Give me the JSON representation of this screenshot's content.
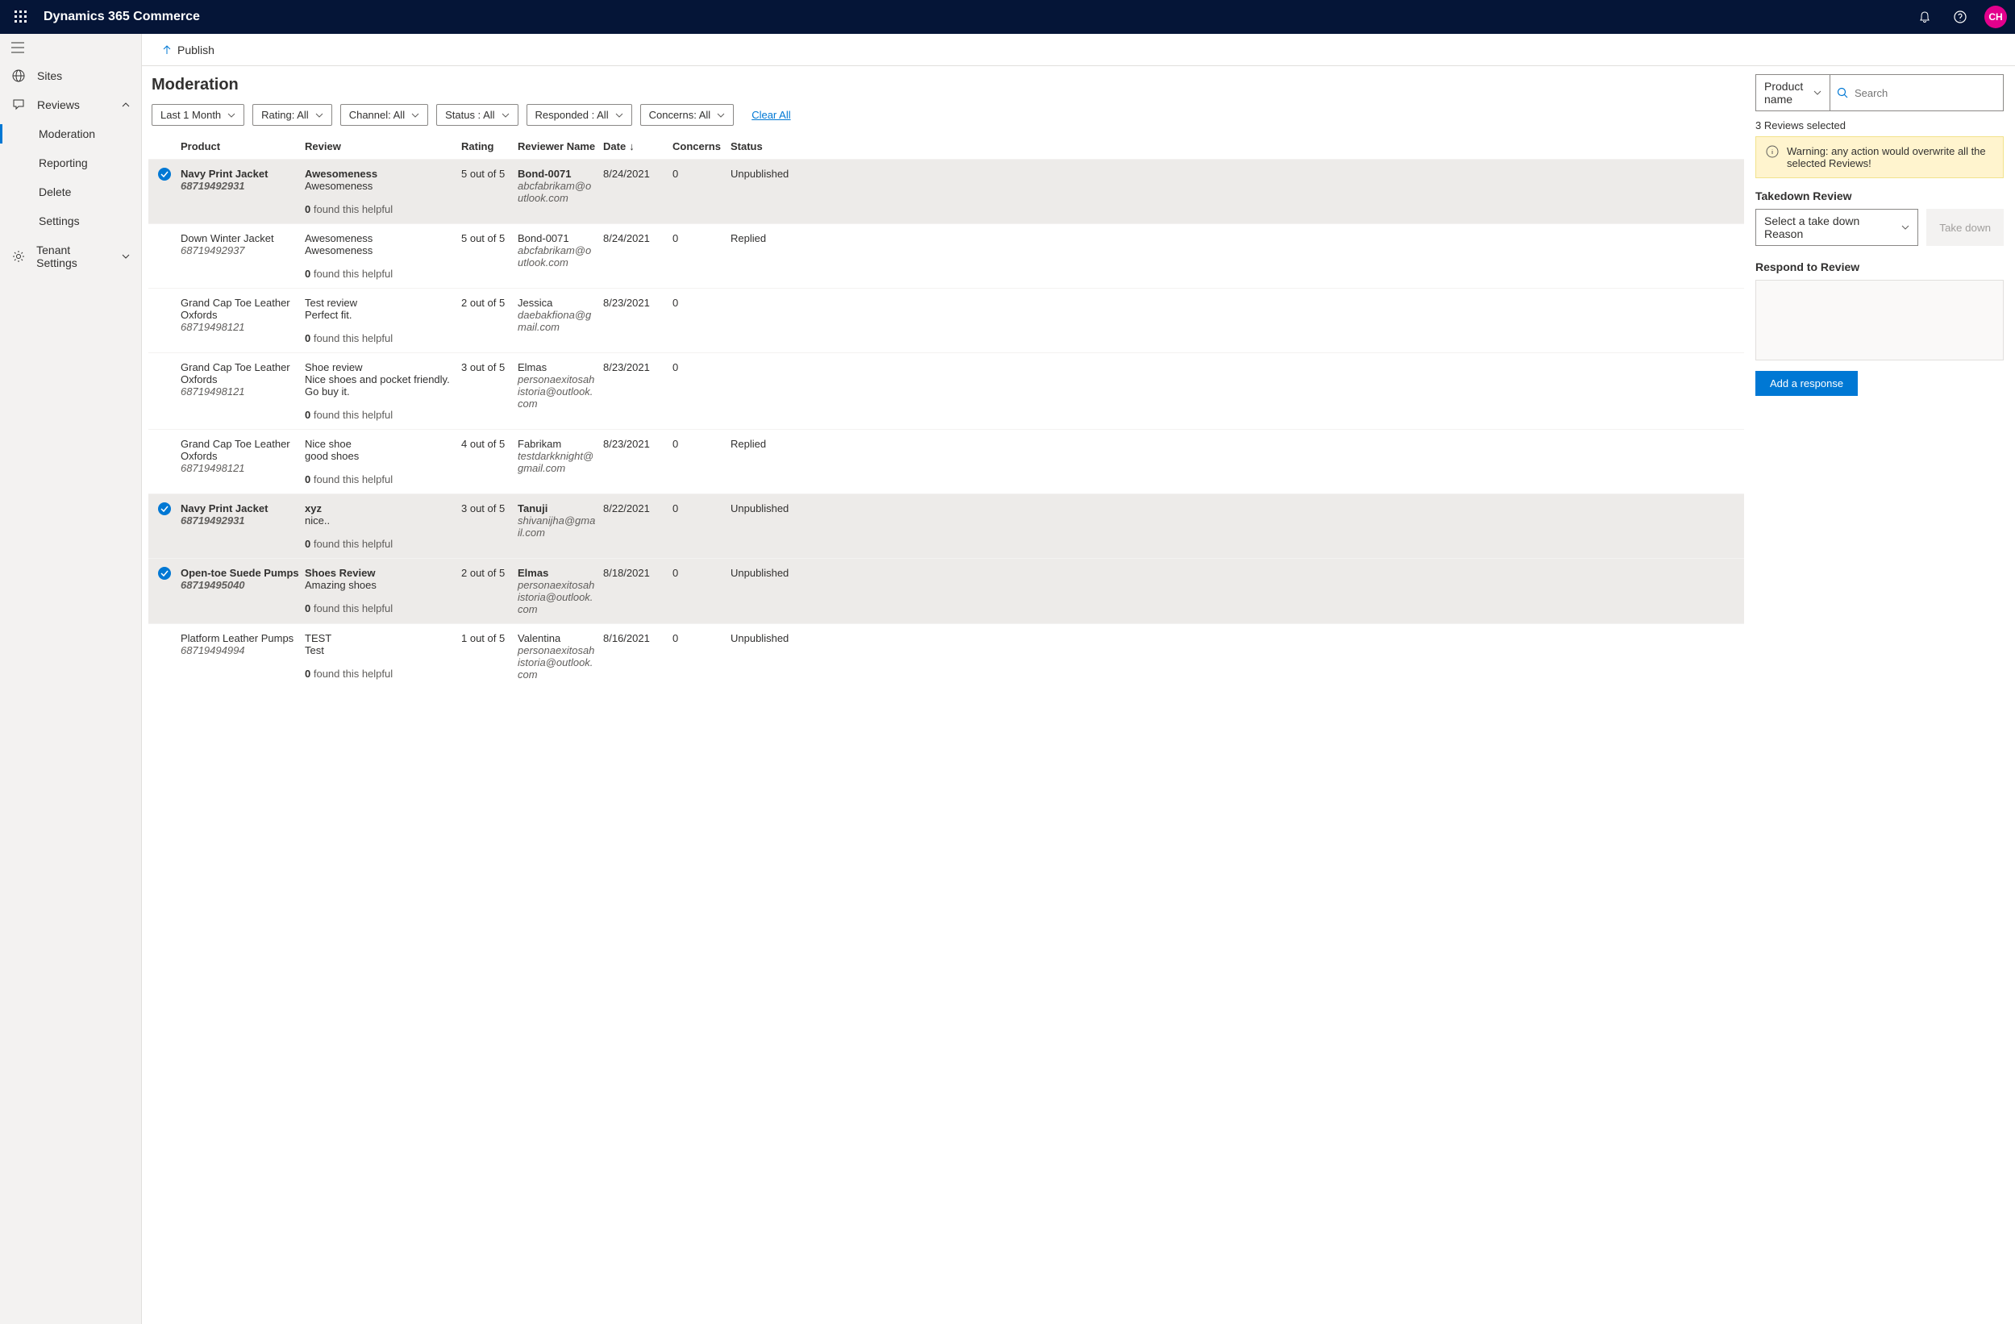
{
  "header": {
    "appTitle": "Dynamics 365 Commerce",
    "avatar": "CH"
  },
  "sidebar": {
    "sites": "Sites",
    "reviews": "Reviews",
    "moderation": "Moderation",
    "reporting": "Reporting",
    "delete": "Delete",
    "settings": "Settings",
    "tenantSettings": "Tenant Settings"
  },
  "cmdbar": {
    "publish": "Publish"
  },
  "pageTitle": "Moderation",
  "filters": {
    "dateRange": "Last 1 Month",
    "rating": "Rating: All",
    "channel": "Channel: All",
    "status": "Status : All",
    "responded": "Responded : All",
    "concerns": "Concerns: All",
    "clearAll": "Clear All"
  },
  "columns": {
    "product": "Product",
    "review": "Review",
    "rating": "Rating",
    "reviewer": "Reviewer Name",
    "date": "Date",
    "concerns": "Concerns",
    "status": "Status"
  },
  "rows": [
    {
      "selected": true,
      "product": "Navy Print Jacket",
      "pid": "68719492931",
      "title": "Awesomeness",
      "body": "Awesomeness",
      "helpful": "0",
      "rating": "5 out of 5",
      "reviewer": "Bond-0071",
      "email": "abcfabrikam@outlook.com",
      "date": "8/24/2021",
      "concerns": "0",
      "status": "Unpublished"
    },
    {
      "selected": false,
      "product": "Down Winter Jacket",
      "pid": "68719492937",
      "title": "Awesomeness",
      "body": "Awesomeness",
      "helpful": "0",
      "rating": "5 out of 5",
      "reviewer": "Bond-0071",
      "email": "abcfabrikam@outlook.com",
      "date": "8/24/2021",
      "concerns": "0",
      "status": "Replied"
    },
    {
      "selected": false,
      "product": "Grand Cap Toe Leather Oxfords",
      "pid": "68719498121",
      "title": "Test review",
      "body": "Perfect fit.",
      "helpful": "0",
      "rating": "2 out of 5",
      "reviewer": "Jessica",
      "email": "daebakfiona@gmail.com",
      "date": "8/23/2021",
      "concerns": "0",
      "status": ""
    },
    {
      "selected": false,
      "product": "Grand Cap Toe Leather Oxfords",
      "pid": "68719498121",
      "title": "Shoe review",
      "body": "Nice shoes and pocket friendly. Go buy it.",
      "helpful": "0",
      "rating": "3 out of 5",
      "reviewer": "Elmas",
      "email": "personaexitosahistoria@outlook.com",
      "date": "8/23/2021",
      "concerns": "0",
      "status": ""
    },
    {
      "selected": false,
      "product": "Grand Cap Toe Leather Oxfords",
      "pid": "68719498121",
      "title": "Nice shoe",
      "body": "good shoes",
      "helpful": "0",
      "rating": "4 out of 5",
      "reviewer": "Fabrikam",
      "email": "testdarkknight@gmail.com",
      "date": "8/23/2021",
      "concerns": "0",
      "status": "Replied"
    },
    {
      "selected": true,
      "product": "Navy Print Jacket",
      "pid": "68719492931",
      "title": "xyz",
      "body": "nice..",
      "helpful": "0",
      "rating": "3 out of 5",
      "reviewer": "Tanuji",
      "email": "shivanijha@gmail.com",
      "date": "8/22/2021",
      "concerns": "0",
      "status": "Unpublished"
    },
    {
      "selected": true,
      "product": "Open-toe Suede Pumps",
      "pid": "68719495040",
      "title": "Shoes Review",
      "body": "Amazing shoes",
      "helpful": "0",
      "rating": "2 out of 5",
      "reviewer": "Elmas",
      "email": "personaexitosahistoria@outlook.com",
      "date": "8/18/2021",
      "concerns": "0",
      "status": "Unpublished"
    },
    {
      "selected": false,
      "product": "Platform Leather Pumps",
      "pid": "68719494994",
      "title": "TEST",
      "body": "Test",
      "helpful": "0",
      "rating": "1 out of 5",
      "reviewer": "Valentina",
      "email": "personaexitosahistoria@outlook.com",
      "date": "8/16/2021",
      "concerns": "0",
      "status": "Unpublished"
    }
  ],
  "helpfulSuffix": " found this helpful",
  "rightPanel": {
    "searchBy": "Product name",
    "searchPlaceholder": "Search",
    "selectedCount": "3 Reviews selected",
    "warning": "Warning: any action would overwrite all the selected Reviews!",
    "takedownTitle": "Takedown Review",
    "takedownPlaceholder": "Select a take down Reason",
    "takedownButton": "Take down",
    "respondTitle": "Respond to Review",
    "addResponse": "Add a response"
  }
}
